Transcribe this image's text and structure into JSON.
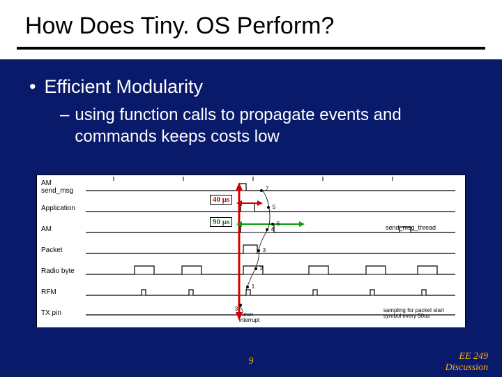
{
  "slide": {
    "title": "How Does Tiny. OS Perform?",
    "bullet1": "Efficient Modularity",
    "bullet2": "using function calls to propagate events and commands keeps costs low",
    "page_number": "9",
    "footer_line1": "EE 249",
    "footer_line2": "Discussion"
  },
  "diagram": {
    "row_labels": [
      "AM",
      "send_msg",
      "Application",
      "AM",
      "Packet",
      "Radio byte",
      "RFM",
      "TX pin"
    ],
    "annot_40": "40 µs",
    "annot_90": "90 µs",
    "right_label": "send_msg_thread",
    "bottom_label1": "Timer",
    "bottom_label2": "interrupt",
    "bottom_right1": "sampling for packet start",
    "bottom_right2": "symbol every 50us",
    "event_nums": [
      "1",
      "2",
      "3",
      "3",
      "4",
      "5",
      "6",
      "7"
    ]
  }
}
